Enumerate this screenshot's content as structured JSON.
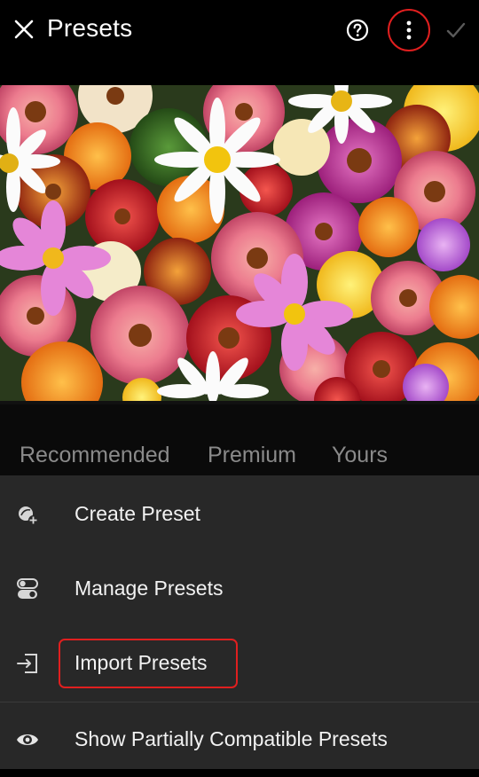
{
  "header": {
    "title": "Presets",
    "close_icon": "close-icon",
    "help_icon": "help-circle-icon",
    "more_icon": "more-vertical-icon",
    "done_icon": "checkmark-icon",
    "highlight_color": "#e01f1f"
  },
  "tabs": [
    {
      "label": "Recommended"
    },
    {
      "label": "Premium"
    },
    {
      "label": "Yours"
    }
  ],
  "menu": {
    "items": [
      {
        "label": "Create Preset",
        "icon": "create-preset-icon"
      },
      {
        "label": "Manage Presets",
        "icon": "toggles-icon"
      },
      {
        "label": "Import Presets",
        "icon": "import-icon"
      },
      {
        "label": "Show Partially Compatible Presets",
        "icon": "eye-icon"
      }
    ]
  },
  "colors": {
    "background": "#000000",
    "menu_background": "#282828",
    "tab_text": "#8a8a8a",
    "accent_outline": "#e01f1f"
  }
}
